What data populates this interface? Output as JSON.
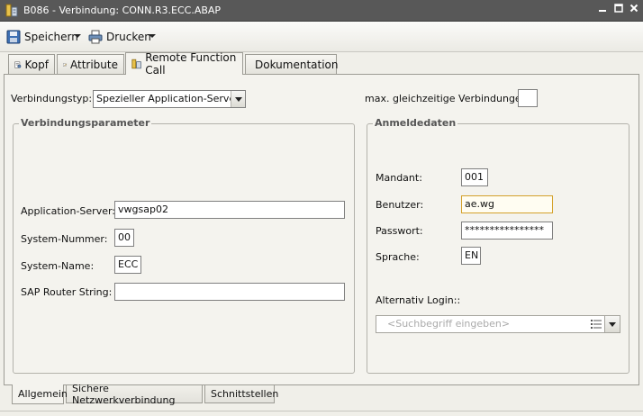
{
  "window": {
    "title": "B086 - Verbindung: CONN.R3.ECC.ABAP",
    "minimize_icon": "minimize-icon",
    "maximize_icon": "maximize-icon",
    "close_icon": "close-icon"
  },
  "toolbar": {
    "save_label": "Speichern",
    "print_label": "Drucken"
  },
  "tabs": [
    {
      "label": "Kopf",
      "icon": "header-icon"
    },
    {
      "label": "Attribute",
      "icon": "edit-icon"
    },
    {
      "label": "Remote Function Call",
      "icon": "rfc-icon",
      "active": true
    },
    {
      "label": "Dokumentation",
      "icon": "documentation-icon"
    }
  ],
  "form": {
    "connection_type_label": "Verbindungstyp:",
    "connection_type_value": "Spezieller Application-Server",
    "max_connections_label": "max. gleichzeitige Verbindungen:",
    "max_connections_value": ""
  },
  "connection_params": {
    "title": "Verbindungsparameter",
    "app_server_label": "Application-Server:",
    "app_server_value": "vwgsap02",
    "system_number_label": "System-Nummer:",
    "system_number_value": "00",
    "system_name_label": "System-Name:",
    "system_name_value": "ECC",
    "router_label": "SAP Router String:",
    "router_value": ""
  },
  "login": {
    "title": "Anmeldedaten",
    "client_label": "Mandant:",
    "client_value": "001",
    "user_label": "Benutzer:",
    "user_value": "ae.wg",
    "password_label": "Passwort:",
    "password_value": "****************",
    "language_label": "Sprache:",
    "language_value": "EN",
    "alt_login_label": "Alternativ Login::",
    "alt_login_placeholder": "<Suchbegriff eingeben>"
  },
  "bottom_tabs": [
    {
      "label": "Allgemein",
      "active": true
    },
    {
      "label": "Sichere Netzwerkverbindung"
    },
    {
      "label": "Schnittstellen"
    }
  ]
}
